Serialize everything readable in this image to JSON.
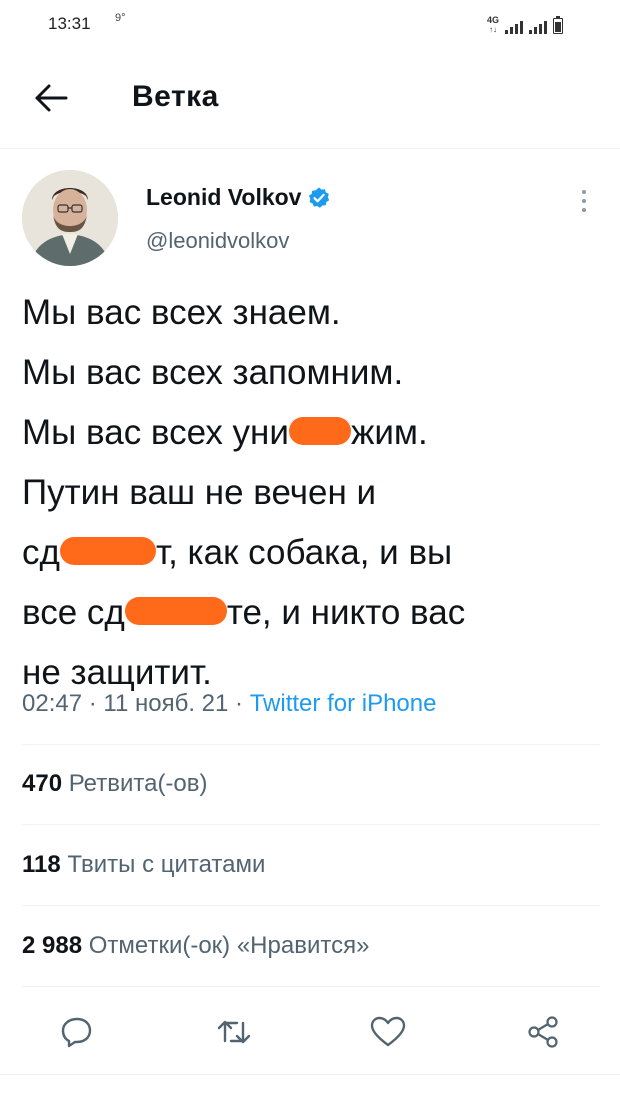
{
  "status_bar": {
    "time": "13:31",
    "temperature": "9°",
    "network": "4G"
  },
  "header": {
    "back_icon": "arrow-left-icon",
    "title": "Ветка"
  },
  "tweet": {
    "author_name": "Leonid Volkov",
    "verified_icon": "verified-badge-icon",
    "handle": "@leonidvolkov",
    "text_lines": [
      [
        "Мы вас всех знаем."
      ],
      [
        "Мы вас всех запомним."
      ],
      [
        "Мы вас всех уни",
        "жим."
      ],
      [
        "Путин ваш не вечен и"
      ],
      [
        "сд",
        "т, как собака, и вы"
      ],
      [
        "все сд",
        "те, и никто вас"
      ],
      [
        "не защитит."
      ]
    ],
    "time": "02:47",
    "date": "11 нояб. 21",
    "separator": "·",
    "source": "Twitter for iPhone"
  },
  "stats": {
    "retweets_count": "470",
    "retweets_label": "Ретвита(-ов)",
    "quotes_count": "118",
    "quotes_label": "Твиты с цитатами",
    "likes_count": "2 988",
    "likes_label": "Отметки(-ок) «Нравится»"
  },
  "actions": [
    "reply-icon",
    "retweet-icon",
    "like-icon",
    "share-icon"
  ],
  "colors": {
    "accent": "#1d9bf0",
    "secondary_text": "#536471",
    "redaction": "#ff6a1a"
  }
}
